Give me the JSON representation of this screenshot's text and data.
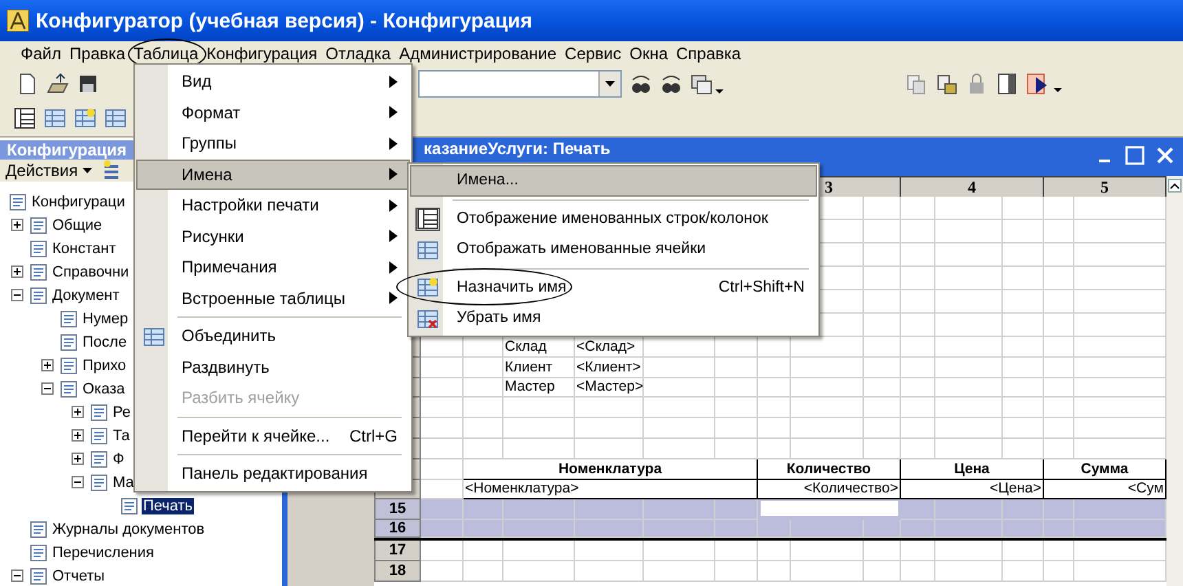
{
  "window": {
    "title": "Конфигуратор (учебная версия) - Конфигурация"
  },
  "menu_bar": [
    {
      "label": "Файл",
      "circled": false
    },
    {
      "label": "Правка",
      "circled": false
    },
    {
      "label": "Таблица",
      "circled": true
    },
    {
      "label": "Конфигурация",
      "circled": false
    },
    {
      "label": "Отладка",
      "circled": false
    },
    {
      "label": "Администрирование",
      "circled": false
    },
    {
      "label": "Сервис",
      "circled": false
    },
    {
      "label": "Окна",
      "circled": false
    },
    {
      "label": "Справка",
      "circled": false
    }
  ],
  "config_panel": {
    "title": "Конфигурация",
    "actions_button": "Действия",
    "tree": [
      {
        "label": "Конфигураци",
        "selected": false,
        "children": [
          {
            "label": "Общие",
            "selected": false,
            "expanded": false
          },
          {
            "label": "Констант",
            "selected": false
          },
          {
            "label": "Справочни",
            "selected": false,
            "expanded": false
          },
          {
            "label": "Документ",
            "selected": false,
            "expanded": true,
            "children": [
              {
                "label": "Нумер",
                "selected": false
              },
              {
                "label": "После",
                "selected": false
              },
              {
                "label": "Прихо",
                "selected": false,
                "expanded": false
              },
              {
                "label": "Оказа",
                "selected": false,
                "expanded": true,
                "children": [
                  {
                    "label": "Ре",
                    "selected": false,
                    "expanded": false
                  },
                  {
                    "label": "Та",
                    "selected": false,
                    "expanded": false
                  },
                  {
                    "label": "Ф",
                    "selected": false,
                    "expanded": false
                  },
                  {
                    "label": "Ма",
                    "selected": false,
                    "expanded": true,
                    "children": [
                      {
                        "label": "Печать",
                        "selected": true
                      }
                    ]
                  }
                ]
              }
            ]
          },
          {
            "label": "Журналы документов",
            "selected": false
          },
          {
            "label": "Перечисления",
            "selected": false
          },
          {
            "label": "Отчеты",
            "selected": false,
            "expanded": true
          }
        ]
      }
    ]
  },
  "document": {
    "title": "казаниеУслуги: Печать",
    "columns": [
      "3",
      "4",
      "5"
    ],
    "rows": [
      {
        "kind": "blank",
        "selected": false,
        "boundary": true
      },
      {
        "kind": "blank",
        "selected": false,
        "boundary": false
      },
      {
        "kind": "blank",
        "selected": false,
        "boundary": true
      },
      {
        "kind": "blank",
        "selected": false,
        "boundary": true
      },
      {
        "kind": "blank",
        "selected": false,
        "boundary": false
      },
      {
        "kind": "blank",
        "selected": false,
        "boundary": false
      },
      {
        "kind": "field",
        "selected": false,
        "boundary": false,
        "label": "Склад",
        "value": "<Склад>"
      },
      {
        "kind": "field",
        "selected": false,
        "boundary": false,
        "label": "Клиент",
        "value": "<Клиент>"
      },
      {
        "kind": "field",
        "selected": false,
        "boundary": true,
        "label": "Мастер",
        "value": "<Мастер>"
      },
      {
        "kind": "blank",
        "selected": false,
        "boundary": false
      },
      {
        "kind": "blank",
        "selected": false,
        "boundary": true
      },
      {
        "kind": "blank",
        "selected": false,
        "boundary": false
      },
      {
        "kind": "table_header",
        "selected": false,
        "boundary": true,
        "cells": [
          "Номенклатура",
          "Количество",
          "Цена",
          "Сумма"
        ]
      },
      {
        "kind": "table_row",
        "selected": false,
        "boundary": false,
        "cells": [
          "<Номенклатура>",
          "<Количество>",
          "<Цена>",
          "<Сум"
        ]
      },
      {
        "kind": "blank",
        "number": "15",
        "selected": true,
        "boundary": false,
        "current_cell": true
      },
      {
        "kind": "blank",
        "number": "16",
        "selected": true,
        "boundary": false
      },
      {
        "kind": "blank",
        "number": "17",
        "selected": false,
        "boundary": false
      },
      {
        "kind": "blank",
        "number": "18",
        "selected": false,
        "boundary": false
      }
    ]
  },
  "table_menu": {
    "items": [
      {
        "label": "Вид",
        "has_submenu": true,
        "has_icon": false,
        "separator_before": false,
        "selected": false,
        "disabled": false
      },
      {
        "label": "Формат",
        "has_submenu": true,
        "has_icon": false,
        "separator_before": false,
        "selected": false,
        "disabled": false
      },
      {
        "label": "Группы",
        "has_submenu": true,
        "has_icon": false,
        "separator_before": false,
        "selected": false,
        "disabled": false
      },
      {
        "label": "Имена",
        "has_submenu": true,
        "has_icon": false,
        "separator_before": false,
        "selected": true,
        "disabled": false
      },
      {
        "label": "Настройки печати",
        "has_submenu": true,
        "has_icon": false,
        "separator_before": false,
        "selected": false,
        "disabled": false
      },
      {
        "label": "Рисунки",
        "has_submenu": true,
        "has_icon": false,
        "separator_before": false,
        "selected": false,
        "disabled": false
      },
      {
        "label": "Примечания",
        "has_submenu": true,
        "has_icon": false,
        "separator_before": false,
        "selected": false,
        "disabled": false
      },
      {
        "label": "Встроенные таблицы",
        "has_submenu": true,
        "has_icon": false,
        "separator_before": false,
        "selected": false,
        "disabled": false
      },
      {
        "label": "Объединить",
        "has_submenu": false,
        "has_icon": true,
        "separator_before": true,
        "selected": false,
        "disabled": false
      },
      {
        "label": "Раздвинуть",
        "has_submenu": false,
        "has_icon": false,
        "separator_before": false,
        "selected": false,
        "disabled": false
      },
      {
        "label": "Разбить ячейку",
        "has_submenu": false,
        "has_icon": false,
        "separator_before": false,
        "selected": false,
        "disabled": true
      },
      {
        "label": "Перейти к ячейке...",
        "shortcut": "Ctrl+G",
        "has_submenu": false,
        "has_icon": false,
        "separator_before": true,
        "selected": false,
        "disabled": false
      },
      {
        "label": "Панель редактирования",
        "has_submenu": false,
        "has_icon": false,
        "separator_before": true,
        "selected": false,
        "disabled": false
      }
    ]
  },
  "names_submenu": {
    "items": [
      {
        "label": "Имена...",
        "has_icon": false,
        "separator_before": false,
        "selected": true,
        "checked": false
      },
      {
        "label": "Отображение именованных строк/колонок",
        "has_icon": true,
        "separator_before": true,
        "selected": false,
        "checked": true
      },
      {
        "label": "Отображать именованные ячейки",
        "has_icon": true,
        "separator_before": false,
        "selected": false,
        "checked": false
      },
      {
        "label": "Назначить имя",
        "shortcut": "Ctrl+Shift+N",
        "has_icon": true,
        "separator_before": true,
        "selected": false,
        "checked": false,
        "circled": true
      },
      {
        "label": "Убрать имя",
        "has_icon": true,
        "separator_before": false,
        "selected": false,
        "checked": false
      }
    ]
  }
}
